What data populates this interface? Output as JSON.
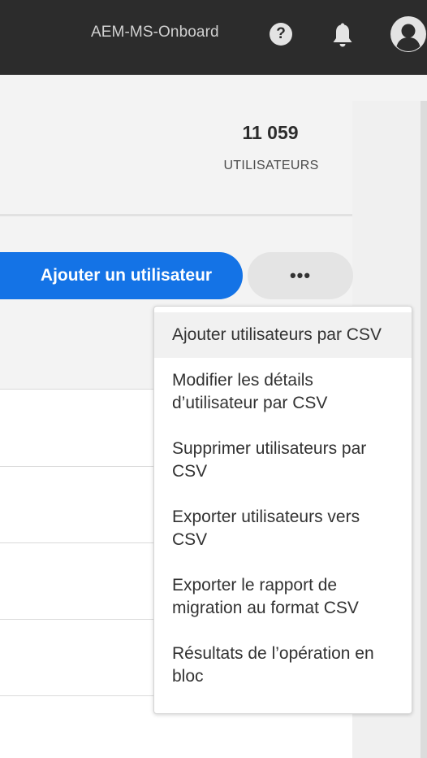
{
  "header": {
    "org_name": "AEM-MS-Onboard",
    "icons": [
      "help-icon",
      "bell-icon",
      "avatar-icon"
    ]
  },
  "stats": {
    "count": "11 059",
    "label": "UTILISATEURS"
  },
  "actions": {
    "add_user_label": "Ajouter un utilisateur",
    "more_label": "•••"
  },
  "menu": {
    "items": [
      "Ajouter utilisateurs par CSV",
      "Modifier les détails d’utilisateur par CSV",
      "Supprimer utilisateurs par CSV",
      "Exporter utilisateurs vers CSV",
      "Exporter le rapport de migration au format CSV",
      "Résultats de l’opération en bloc"
    ],
    "hovered_index": 0
  },
  "colors": {
    "topbar": "#2c2c2c",
    "accent": "#1473e6"
  }
}
